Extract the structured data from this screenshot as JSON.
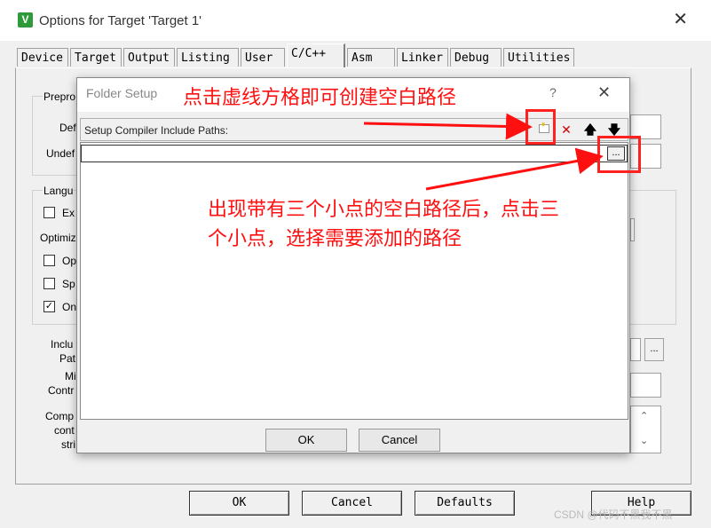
{
  "window": {
    "title": "Options for Target 'Target 1'",
    "app_icon": "keil-uvision-icon"
  },
  "tabs": [
    {
      "label": "Device"
    },
    {
      "label": "Target"
    },
    {
      "label": "Output"
    },
    {
      "label": "Listing"
    },
    {
      "label": "User"
    },
    {
      "label": "C/C++",
      "active": true
    },
    {
      "label": "Asm"
    },
    {
      "label": "Linker"
    },
    {
      "label": "Debug"
    },
    {
      "label": "Utilities"
    }
  ],
  "background": {
    "preproc": "Prepro",
    "define": "Def",
    "undefine": "Undef",
    "language": "Langu",
    "ex": "Ex",
    "optimize": "Optimiz",
    "op": "Op",
    "sp": "Sp",
    "on": "On",
    "include_paths": [
      "Inclu",
      "Pat"
    ],
    "misc": [
      "Mi",
      "Contr"
    ],
    "compiler": [
      "Comp",
      "cont",
      "stri"
    ],
    "ellipsis": "..."
  },
  "bottom_buttons": {
    "ok": "OK",
    "cancel": "Cancel",
    "defaults": "Defaults",
    "help": "Help"
  },
  "dialog": {
    "title": "Folder Setup",
    "help": "?",
    "header_label": "Setup Compiler Include Paths:",
    "toolbar": [
      "new-folder-icon",
      "delete-icon",
      "move-up-icon",
      "move-down-icon"
    ],
    "path_value": "",
    "ellipsis": "...",
    "ok_label": "OK",
    "cancel_label": "Cancel"
  },
  "annotations": {
    "note1": "点击虚线方格即可创建空白路径",
    "note2_line1": "出现带有三个小点的空白路径后，点击三",
    "note2_line2": "个小点，选择需要添加的路径",
    "color": "#ff1010"
  },
  "watermark": "CSDN @代码不黑我不黑"
}
